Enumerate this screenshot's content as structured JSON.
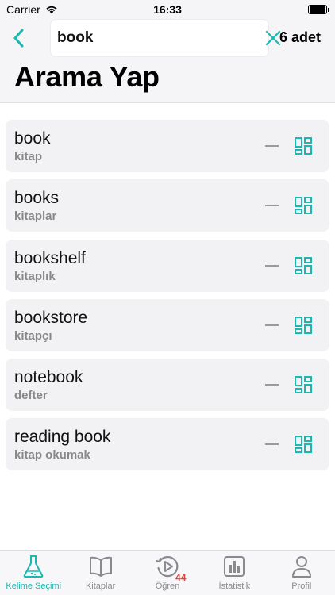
{
  "status_bar": {
    "carrier": "Carrier",
    "time": "16:33",
    "battery_level": 1.0
  },
  "header": {
    "search_value": "book",
    "result_count": "6 adet",
    "title": "Arama Yap"
  },
  "words": [
    {
      "term": "book",
      "meaning": "kitap"
    },
    {
      "term": "books",
      "meaning": "kitaplar"
    },
    {
      "term": "bookshelf",
      "meaning": "kitaplık"
    },
    {
      "term": "bookstore",
      "meaning": "kitapçı"
    },
    {
      "term": "notebook",
      "meaning": "defter"
    },
    {
      "term": "reading book",
      "meaning": "kitap okumak"
    }
  ],
  "tabs": [
    {
      "label": "Kelime Seçimi",
      "icon": "flask-icon",
      "active": true
    },
    {
      "label": "Kitaplar",
      "icon": "book-open-icon",
      "active": false
    },
    {
      "label": "Öğren",
      "icon": "replay-icon",
      "active": false,
      "badge": "44"
    },
    {
      "label": "İstatistik",
      "icon": "bar-chart-icon",
      "active": false
    },
    {
      "label": "Profil",
      "icon": "person-icon",
      "active": false
    }
  ],
  "colors": {
    "accent": "#1bb8b0",
    "badge": "#e0463a",
    "card_bg": "#f2f2f5"
  }
}
